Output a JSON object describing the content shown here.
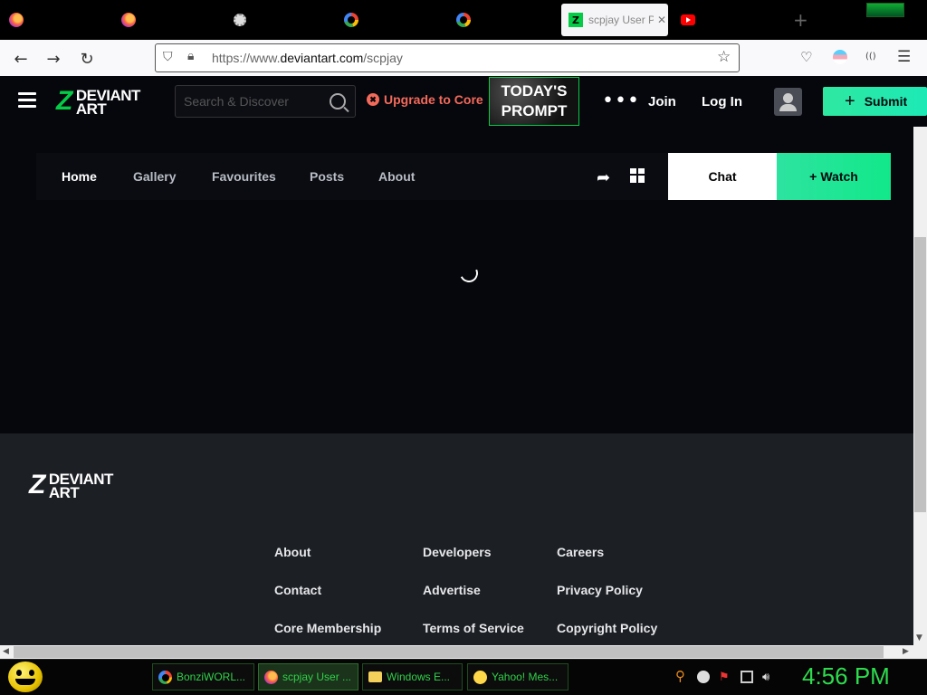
{
  "browser": {
    "active_tab_title": "scpjay User Profile",
    "active_tab_close": "✕",
    "url_prefix": "https://www.",
    "url_domain": "deviantart.com",
    "url_path": "/scpjay"
  },
  "header": {
    "logo_line1": "DEVIANT",
    "logo_line2": "ART",
    "search_placeholder": "Search & Discover",
    "upgrade_label": "Upgrade to Core",
    "prompt_line1": "TODAY'S",
    "prompt_line2": "PROMPT",
    "more_label": "•••",
    "join_label": "Join",
    "login_label": "Log In",
    "submit_label": "Submit"
  },
  "profile_nav": {
    "tabs": [
      "Home",
      "Gallery",
      "Favourites",
      "Posts",
      "About"
    ],
    "chat_label": "Chat",
    "watch_label": "Watch"
  },
  "footer": {
    "logo_line1": "DEVIANT",
    "logo_line2": "ART",
    "col1": [
      "About",
      "Contact",
      "Core Membership"
    ],
    "col2": [
      "Developers",
      "Advertise",
      "Terms of Service"
    ],
    "col3": [
      "Careers",
      "Privacy Policy",
      "Copyright Policy"
    ]
  },
  "taskbar": {
    "items": [
      "BonziWORL...",
      "scpjay User ...",
      "Windows E...",
      "Yahoo! Mes..."
    ],
    "clock": "4:56 PM"
  },
  "colors": {
    "accent": "#05cc47",
    "upgrade": "#f46a5a",
    "taskbar_text": "#31d04a"
  }
}
